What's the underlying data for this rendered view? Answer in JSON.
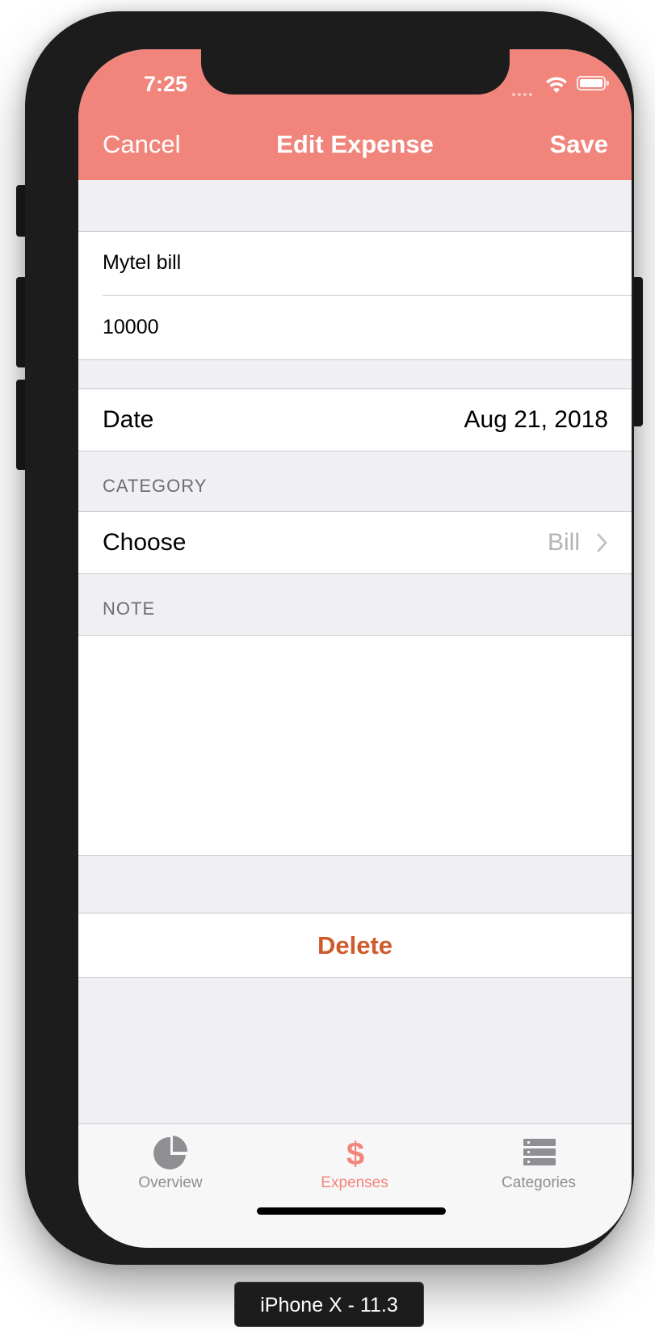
{
  "status_bar": {
    "time": "7:25"
  },
  "nav": {
    "cancel": "Cancel",
    "title": "Edit Expense",
    "save": "Save"
  },
  "form": {
    "name_value": "Mytel bill",
    "amount_value": "10000",
    "date_label": "Date",
    "date_value": "Aug 21, 2018",
    "category_header": "CATEGORY",
    "category_label": "Choose",
    "category_value": "Bill",
    "note_header": "NOTE",
    "note_value": "",
    "delete_label": "Delete"
  },
  "tabs": [
    {
      "label": "Overview",
      "icon": "pie-chart-icon",
      "active": false
    },
    {
      "label": "Expenses",
      "icon": "dollar-icon",
      "active": true
    },
    {
      "label": "Categories",
      "icon": "list-icon",
      "active": false
    }
  ],
  "device_label": "iPhone X - 11.3",
  "colors": {
    "accent": "#f1857c",
    "delete": "#cf5b2a",
    "background": "#efeff4"
  }
}
